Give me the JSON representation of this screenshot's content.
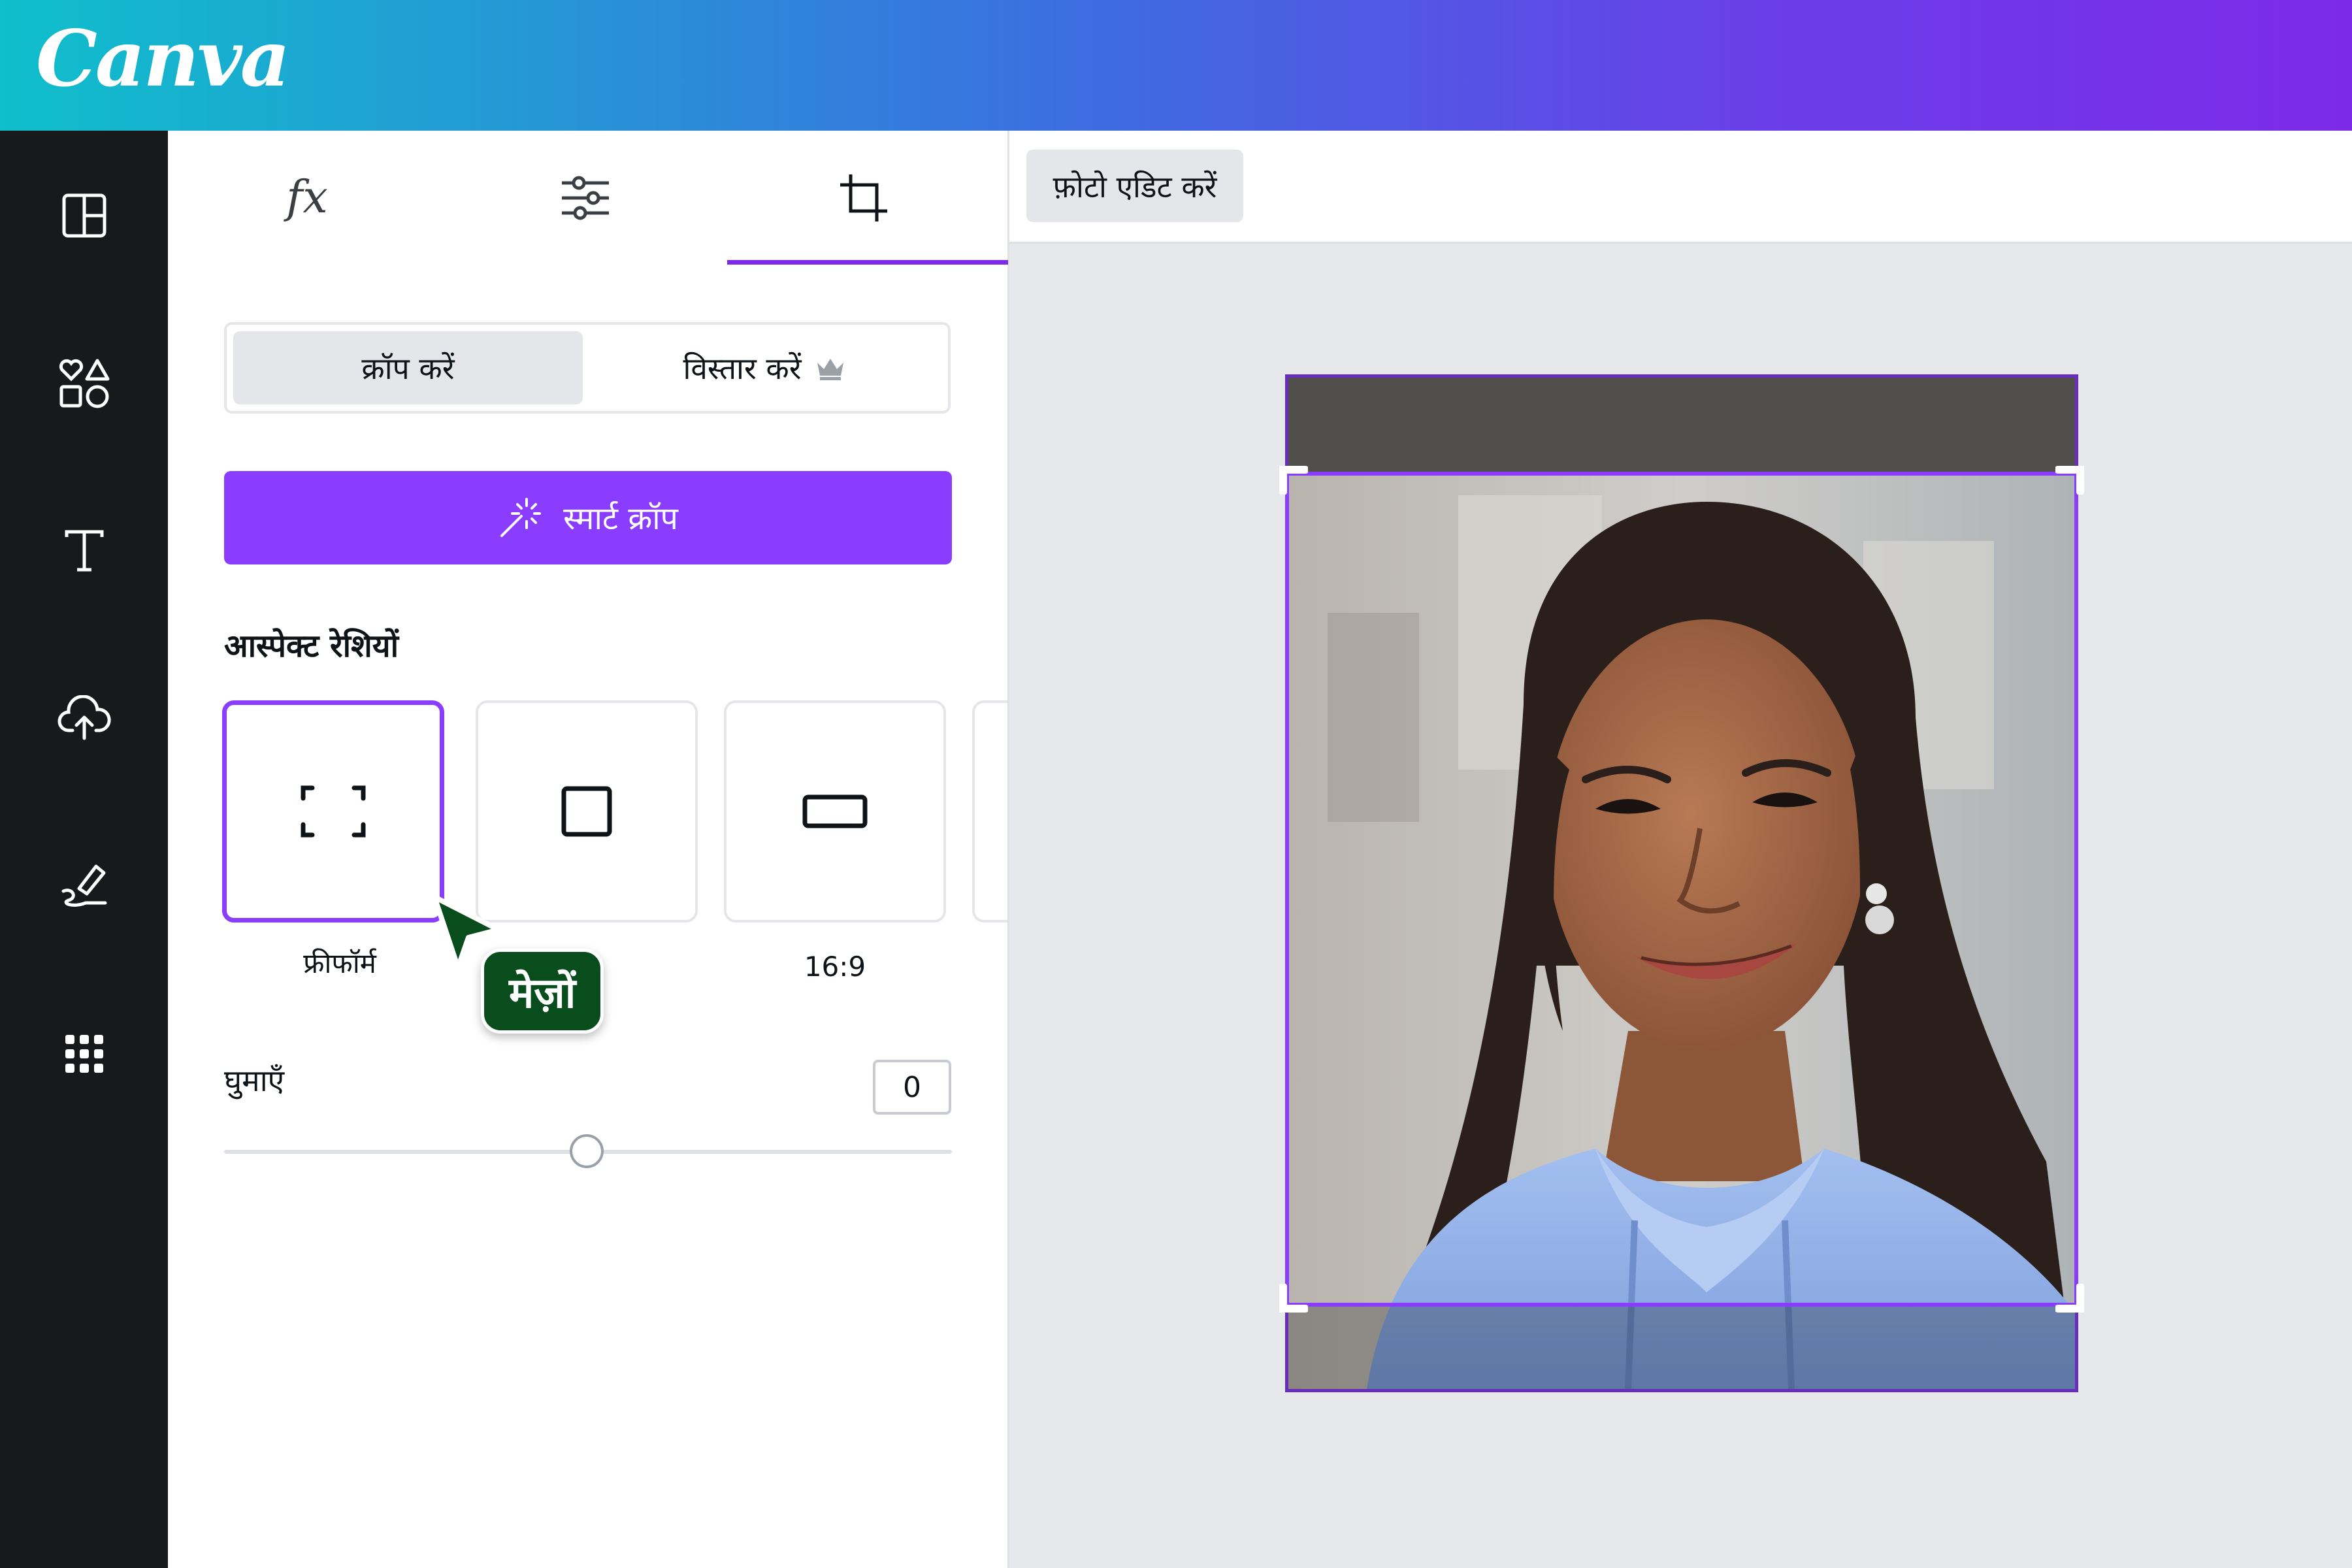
{
  "header": {
    "logo_text": "Canva",
    "gradient": [
      "#0fbfcb",
      "#7d2ae8"
    ]
  },
  "rail": {
    "items": [
      {
        "icon": "layout-icon"
      },
      {
        "icon": "elements-icon"
      },
      {
        "icon": "text-icon"
      },
      {
        "icon": "upload-cloud-icon"
      },
      {
        "icon": "draw-icon"
      },
      {
        "icon": "apps-grid-icon"
      }
    ]
  },
  "panel": {
    "tabs": [
      {
        "icon": "effects-fx-icon",
        "label": "fx"
      },
      {
        "icon": "adjust-sliders-icon"
      },
      {
        "icon": "crop-icon",
        "active": true
      }
    ],
    "mode_toggle": {
      "crop_label": "क्रॉप करें",
      "expand_label": "विस्तार करें",
      "expand_badge": "crown-icon",
      "selected": "crop"
    },
    "smart_crop_label": "स्मार्ट क्रॉप",
    "aspect_heading": "आस्पेक्ट रेशियों",
    "aspect_ratios": [
      {
        "icon": "freeform-icon",
        "label": "फ्रीफॉर्म",
        "selected": true
      },
      {
        "icon": "square-icon",
        "label": ""
      },
      {
        "icon": "widescreen-icon",
        "label": "16:9"
      }
    ],
    "rotate": {
      "label": "घुमाएँ",
      "value": "0",
      "slider_position": 0.5
    }
  },
  "pointer_tooltip": "मेज़ों",
  "canvas": {
    "edit_photo_label": "फ़ोटो एडिट करें"
  },
  "colors": {
    "accent": "#8b3dff",
    "rail_bg": "#18191b",
    "tooltip_bg": "#0a4d1d"
  }
}
